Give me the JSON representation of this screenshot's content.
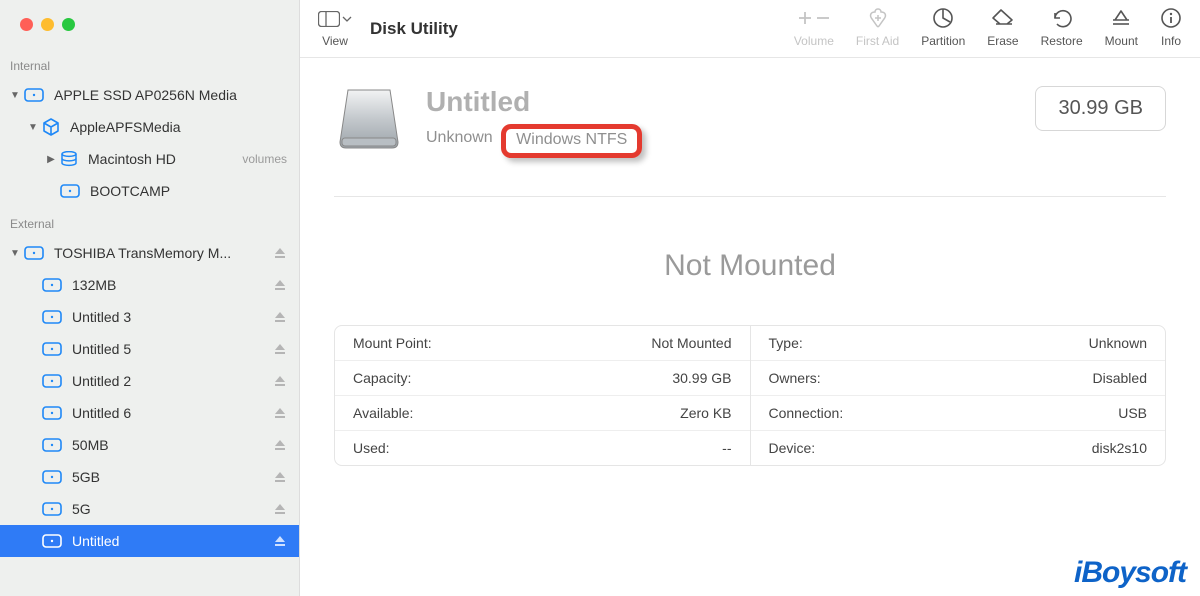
{
  "app_title": "Disk Utility",
  "toolbar": {
    "view_label": "View",
    "actions": [
      {
        "id": "volume",
        "label": "Volume",
        "enabled": false
      },
      {
        "id": "firstaid",
        "label": "First Aid",
        "enabled": false
      },
      {
        "id": "partition",
        "label": "Partition",
        "enabled": true
      },
      {
        "id": "erase",
        "label": "Erase",
        "enabled": true
      },
      {
        "id": "restore",
        "label": "Restore",
        "enabled": true
      },
      {
        "id": "mount",
        "label": "Mount",
        "enabled": true
      },
      {
        "id": "info",
        "label": "Info",
        "enabled": true
      }
    ]
  },
  "sidebar": {
    "sections": {
      "internal": {
        "header": "Internal",
        "items": [
          {
            "label": "APPLE SSD AP0256N Media",
            "iconType": "disk",
            "indent": 0,
            "disclosure": "down",
            "ejectable": false
          },
          {
            "label": "AppleAPFSMedia",
            "iconType": "box",
            "indent": 1,
            "disclosure": "down",
            "ejectable": false
          },
          {
            "label": "Macintosh HD",
            "iconType": "stack",
            "indent": 2,
            "disclosure": "right",
            "sub": "volumes",
            "ejectable": false
          },
          {
            "label": "BOOTCAMP",
            "iconType": "disk",
            "indent": 3,
            "disclosure": "",
            "ejectable": false
          }
        ]
      },
      "external": {
        "header": "External",
        "items": [
          {
            "label": "TOSHIBA TransMemory M...",
            "iconType": "disk",
            "indent": 0,
            "disclosure": "down",
            "ejectable": true
          },
          {
            "label": "132MB",
            "iconType": "disk",
            "indent": 1,
            "disclosure": "",
            "ejectable": true
          },
          {
            "label": "Untitled 3",
            "iconType": "disk",
            "indent": 1,
            "disclosure": "",
            "ejectable": true
          },
          {
            "label": "Untitled 5",
            "iconType": "disk",
            "indent": 1,
            "disclosure": "",
            "ejectable": true
          },
          {
            "label": "Untitled 2",
            "iconType": "disk",
            "indent": 1,
            "disclosure": "",
            "ejectable": true
          },
          {
            "label": "Untitled 6",
            "iconType": "disk",
            "indent": 1,
            "disclosure": "",
            "ejectable": true
          },
          {
            "label": "50MB",
            "iconType": "disk",
            "indent": 1,
            "disclosure": "",
            "ejectable": true
          },
          {
            "label": "5GB",
            "iconType": "disk",
            "indent": 1,
            "disclosure": "",
            "ejectable": true
          },
          {
            "label": "5G",
            "iconType": "disk",
            "indent": 1,
            "disclosure": "",
            "ejectable": true
          },
          {
            "label": "Untitled",
            "iconType": "disk",
            "indent": 1,
            "disclosure": "",
            "ejectable": true,
            "selected": true
          }
        ]
      }
    }
  },
  "volume": {
    "name": "Untitled",
    "format_prefix": "Unknown",
    "format_highlight": "Windows NTFS",
    "size": "30.99 GB",
    "status": "Not Mounted",
    "details_left": [
      {
        "key": "Mount Point:",
        "val": "Not Mounted"
      },
      {
        "key": "Capacity:",
        "val": "30.99 GB"
      },
      {
        "key": "Available:",
        "val": "Zero KB"
      },
      {
        "key": "Used:",
        "val": "--"
      }
    ],
    "details_right": [
      {
        "key": "Type:",
        "val": "Unknown"
      },
      {
        "key": "Owners:",
        "val": "Disabled"
      },
      {
        "key": "Connection:",
        "val": "USB"
      },
      {
        "key": "Device:",
        "val": "disk2s10"
      }
    ]
  },
  "watermark": "iBoysoft"
}
